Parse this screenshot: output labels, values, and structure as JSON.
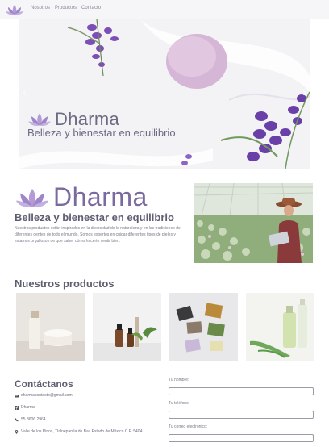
{
  "nav": {
    "links": [
      "Nosotros",
      "Productos",
      "Contacto"
    ]
  },
  "hero": {
    "brand": "Dharma",
    "tagline": "Belleza y bienestar en equilibrio",
    "prev_icon": "‹",
    "next_icon": "›"
  },
  "about": {
    "brand": "Dharma",
    "title": "Belleza y bienestar en equilibrio",
    "text": "Nuestros productos están inspirados en la diversidad de la naturaleza y en las tradiciones de diferentes gentes de todo el mundo. Somos expertos en cuidar diferentes tipos de pieles y estamos orgullosos de que saber cómo hacerte sentir bien."
  },
  "products": {
    "title": "Nuestros productos"
  },
  "contact": {
    "title": "Contáctanos",
    "email": "dharmacontacto@gmail.com",
    "facebook": "Dharma",
    "phone": "55 3606 2964",
    "address": "Valle de los Pinos, Tlalnepantla de Baz Estado de México C.P. 5404",
    "form": {
      "name_label": "Tu nombre:",
      "phone_label": "Tu teléfono:",
      "email_label": "Tu correo electrónico:"
    }
  },
  "colors": {
    "brand_purple": "#7b6a9e",
    "lotus": "#9f86c9",
    "text": "#5e5e72"
  }
}
